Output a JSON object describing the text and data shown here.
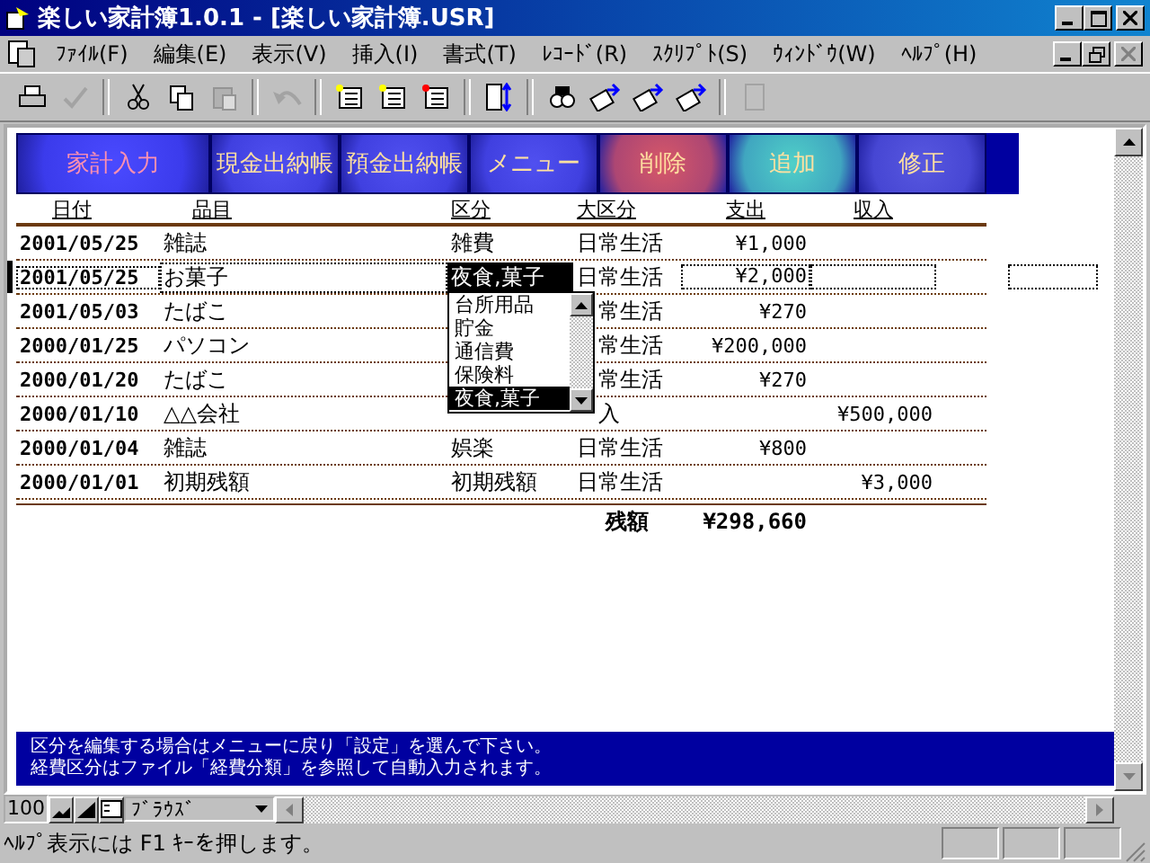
{
  "window": {
    "title": "楽しい家計簿1.0.1 - [楽しい家計簿.USR]"
  },
  "menu": [
    "ﾌｧｲﾙ(F)",
    "編集(E)",
    "表示(V)",
    "挿入(I)",
    "書式(T)",
    "ﾚｺｰﾄﾞ(R)",
    "ｽｸﾘﾌﾟﾄ(S)",
    "ｳｨﾝﾄﾞｳ(W)",
    "ﾍﾙﾌﾟ(H)"
  ],
  "toolbar": [
    {
      "kind": "print",
      "disabled": false
    },
    {
      "kind": "spell",
      "disabled": true
    },
    {
      "kind": "cut",
      "disabled": false
    },
    {
      "kind": "copy",
      "disabled": false
    },
    {
      "kind": "paste",
      "disabled": true
    },
    {
      "kind": "undo",
      "disabled": true
    },
    {
      "kind": "record",
      "disabled": false
    },
    {
      "kind": "record",
      "disabled": false
    },
    {
      "kind": "record",
      "disabled": false
    },
    {
      "kind": "sort",
      "disabled": false
    },
    {
      "kind": "find",
      "disabled": false
    },
    {
      "kind": "filter",
      "disabled": false
    },
    {
      "kind": "filter",
      "disabled": false
    },
    {
      "kind": "filter",
      "disabled": false
    },
    {
      "kind": "db",
      "disabled": true
    }
  ],
  "nav_buttons": [
    {
      "label": "家計入力",
      "color": "#4a4aff"
    },
    {
      "label": "現金出納帳",
      "color": "#5050f0"
    },
    {
      "label": "預金出納帳",
      "color": "#5050f0"
    },
    {
      "label": "メニュー",
      "color": "#5050f0"
    },
    {
      "label": "削除",
      "color": "#d85868"
    },
    {
      "label": "追加",
      "color": "#50d0c8"
    },
    {
      "label": "修正",
      "color": "#5858e0"
    }
  ],
  "table": {
    "columns": [
      "日付",
      "品目",
      "区分",
      "大区分",
      "支出",
      "収入"
    ],
    "rows": [
      {
        "date": "2001/05/25",
        "item": "雑誌",
        "category": "雑費",
        "group": "日常生活",
        "expense": "¥1,000",
        "income": "",
        "selected": false
      },
      {
        "date": "2001/05/25",
        "item": "お菓子",
        "category": "夜食,菓子",
        "group": "日常生活",
        "expense": "¥2,000",
        "income": "",
        "selected": true
      },
      {
        "date": "2001/05/03",
        "item": "たばこ",
        "category": "",
        "group": "常生活",
        "expense": "¥270",
        "income": "",
        "selected": false
      },
      {
        "date": "2000/01/25",
        "item": "パソコン",
        "category": "",
        "group": "常生活",
        "expense": "¥200,000",
        "income": "",
        "selected": false
      },
      {
        "date": "2000/01/20",
        "item": "たばこ",
        "category": "",
        "group": "常生活",
        "expense": "¥270",
        "income": "",
        "selected": false
      },
      {
        "date": "2000/01/10",
        "item": "△△会社",
        "category": "",
        "group": "入",
        "expense": "",
        "income": "¥500,000",
        "selected": false
      },
      {
        "date": "2000/01/04",
        "item": "雑誌",
        "category": "娯楽",
        "group": "日常生活",
        "expense": "¥800",
        "income": "",
        "selected": false
      },
      {
        "date": "2000/01/01",
        "item": "初期残額",
        "category": "初期残額",
        "group": "日常生活",
        "expense": "",
        "income": "¥3,000",
        "selected": false
      }
    ],
    "total_label": "残額",
    "total_value": "¥298,660"
  },
  "dropdown": [
    {
      "label": "台所用品",
      "selected": false
    },
    {
      "label": "貯金",
      "selected": false
    },
    {
      "label": "通信費",
      "selected": false
    },
    {
      "label": "保険料",
      "selected": false
    },
    {
      "label": "夜食,菓子",
      "selected": true
    }
  ],
  "info": [
    "区分を編集する場合はメニューに戻り「設定」を選んで下さい。",
    "経費区分はファイル「経費分類」を参照して自動入力されます。"
  ],
  "nav_bar": {
    "zoom": "100",
    "view": "ﾌﾞﾗｳｽﾞ"
  },
  "status_bar": "ﾍﾙﾌﾟ表示には F1 ｷｰを押します。"
}
